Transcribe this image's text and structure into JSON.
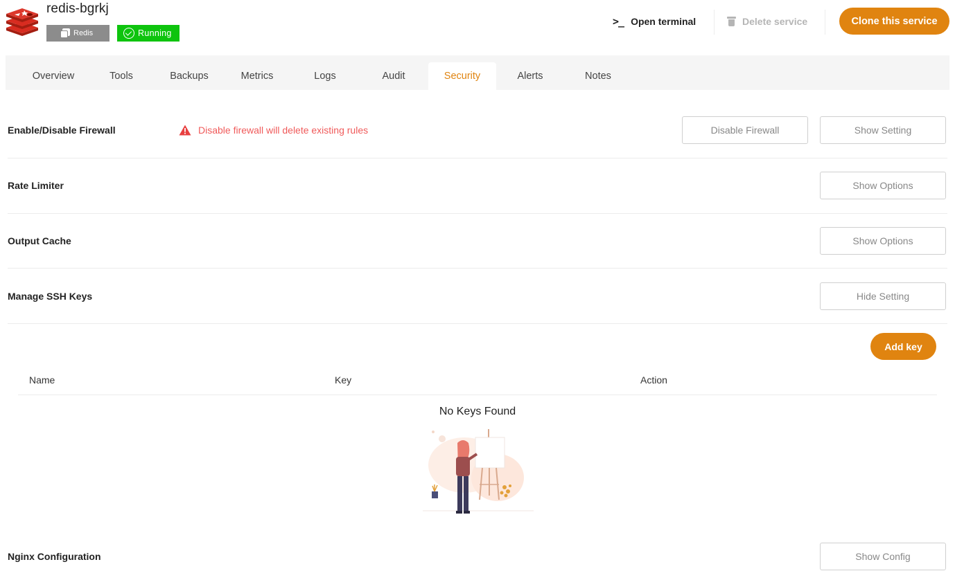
{
  "service": {
    "name": "redis-bgrkj",
    "type_badge": "Redis",
    "status_badge": "Running"
  },
  "header_actions": {
    "open_terminal": "Open terminal",
    "delete_service": "Delete service",
    "clone_service": "Clone this service"
  },
  "tabs": [
    {
      "label": "Overview"
    },
    {
      "label": "Tools"
    },
    {
      "label": "Backups"
    },
    {
      "label": "Metrics"
    },
    {
      "label": "Logs"
    },
    {
      "label": "Audit"
    },
    {
      "label": "Security",
      "active": true
    },
    {
      "label": "Alerts"
    },
    {
      "label": "Notes"
    }
  ],
  "sections": {
    "firewall": {
      "title": "Enable/Disable Firewall",
      "warning": "Disable firewall will delete existing rules",
      "toggle_button": "Disable Firewall",
      "setting_button": "Show Setting"
    },
    "rate_limiter": {
      "title": "Rate Limiter",
      "button": "Show Options"
    },
    "output_cache": {
      "title": "Output Cache",
      "button": "Show Options"
    },
    "ssh_keys": {
      "title": "Manage SSH Keys",
      "button": "Hide Setting",
      "add_button": "Add key",
      "columns": [
        "Name",
        "Key",
        "Action"
      ],
      "empty_message": "No Keys Found"
    },
    "nginx": {
      "title": "Nginx Configuration",
      "button": "Show Config"
    }
  },
  "colors": {
    "accent": "#e08410",
    "running": "#0ec40e",
    "warning": "#f05a5a",
    "redis_logo": "#c6302b"
  },
  "icons": [
    "redis-logo-icon",
    "stack-icon",
    "check-circle-icon",
    "terminal-icon",
    "trash-icon",
    "warning-triangle-icon",
    "empty-state-illustration"
  ]
}
